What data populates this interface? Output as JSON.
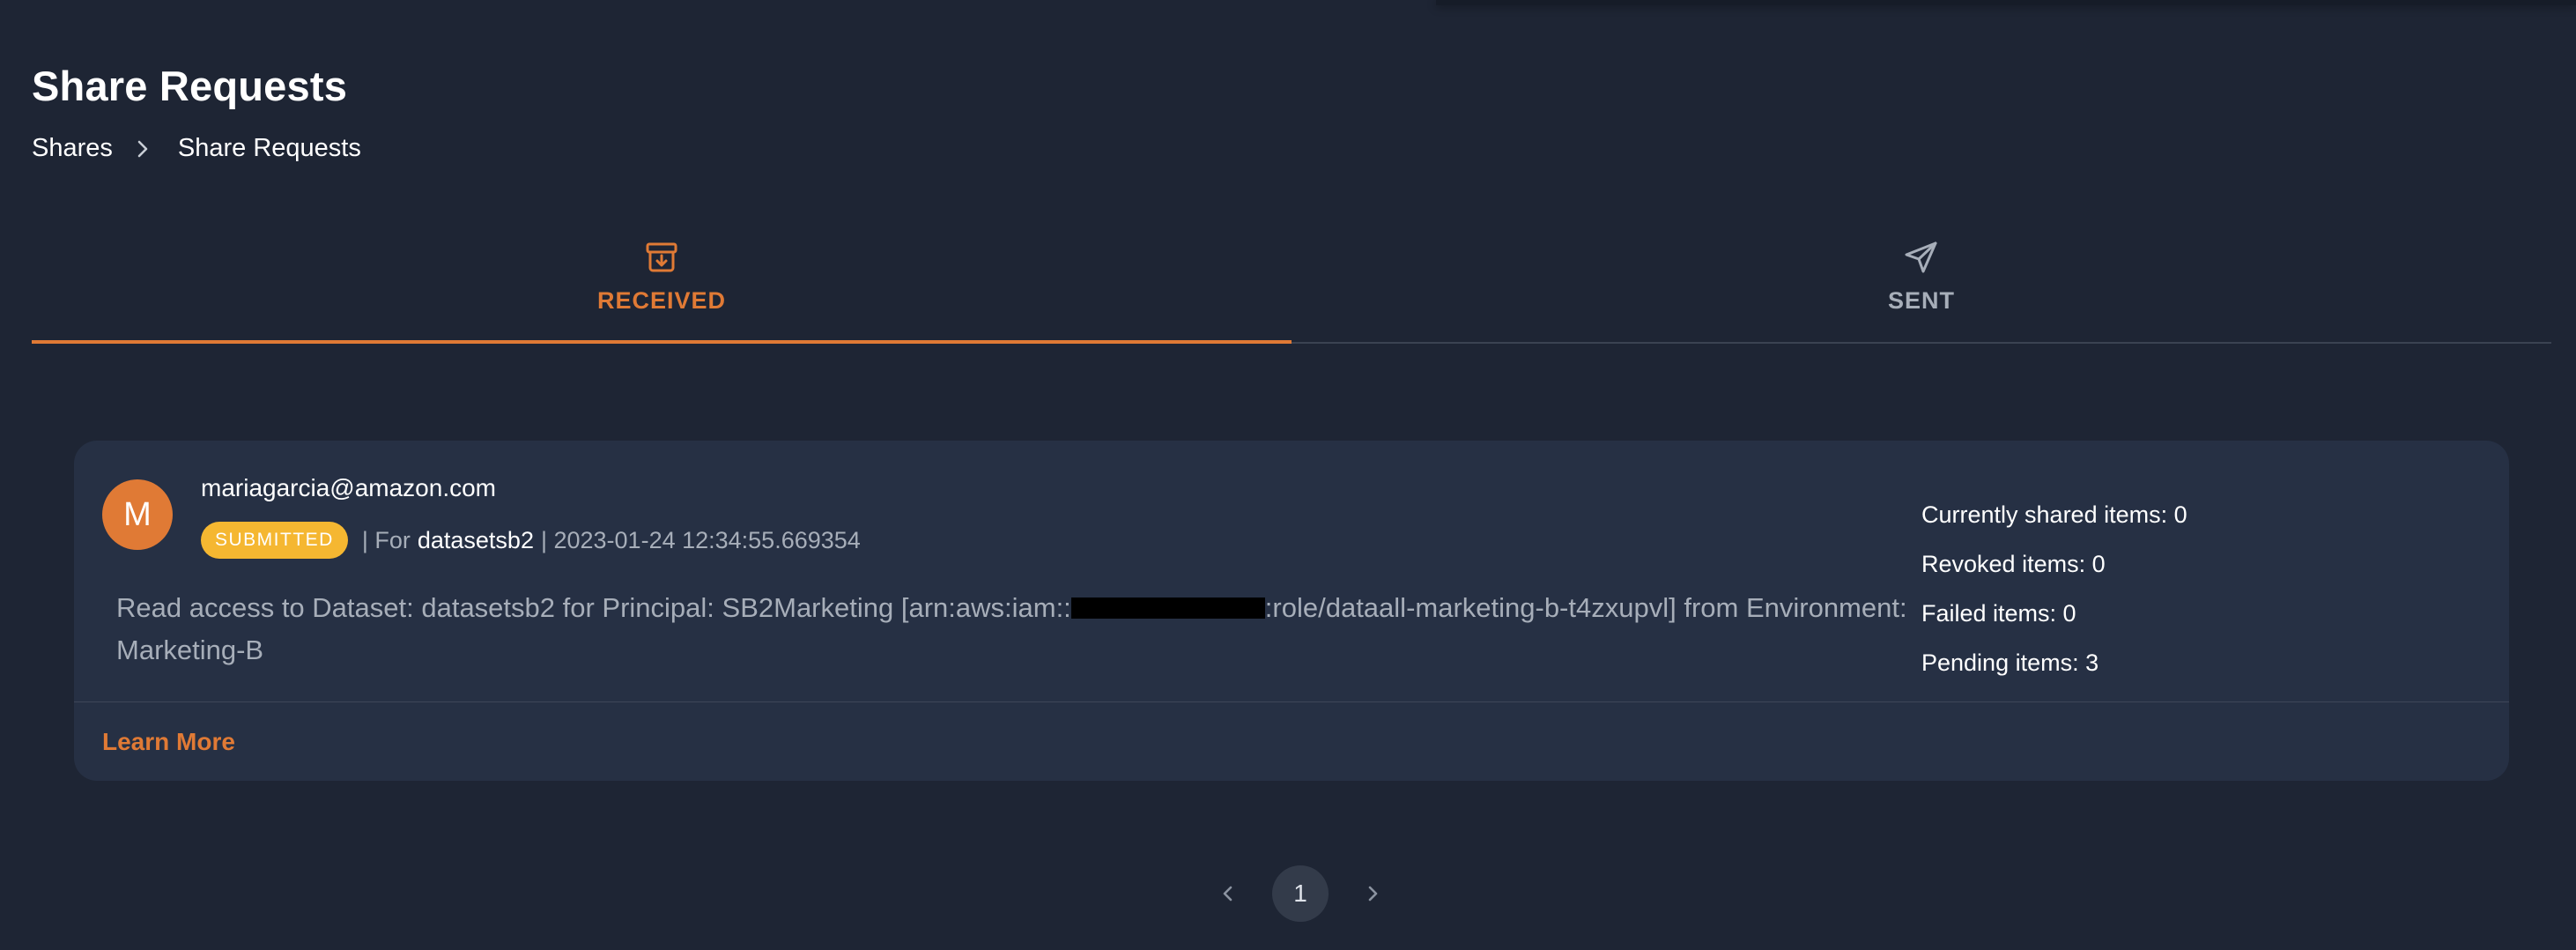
{
  "page": {
    "title": "Share Requests"
  },
  "breadcrumb": {
    "items": [
      "Shares",
      "Share Requests"
    ]
  },
  "tabs": [
    {
      "label": "RECEIVED",
      "icon": "inbox-icon",
      "active": true
    },
    {
      "label": "SENT",
      "icon": "send-icon",
      "active": false
    }
  ],
  "request": {
    "avatar_initial": "M",
    "requester": "mariagarcia@amazon.com",
    "status": "SUBMITTED",
    "for_label": "| For",
    "dataset": "datasetsb2",
    "created": "| 2023-01-24 12:34:55.669354",
    "description_start": "Read access to Dataset: datasetsb2 for Principal: SB2Marketing [arn:aws:iam::",
    "description_end": ":role/dataall-marketing-b-t4zxupvl] from Environment: Marketing-B",
    "stats": [
      "Currently shared items: 0",
      "Revoked items: 0",
      "Failed items: 0",
      "Pending items: 3"
    ],
    "learn_more": "Learn More"
  },
  "pagination": {
    "current_page": "1"
  },
  "colors": {
    "accent": "#e07a35",
    "badge": "#f5b731",
    "background": "#1e2534",
    "card": "#263044"
  }
}
